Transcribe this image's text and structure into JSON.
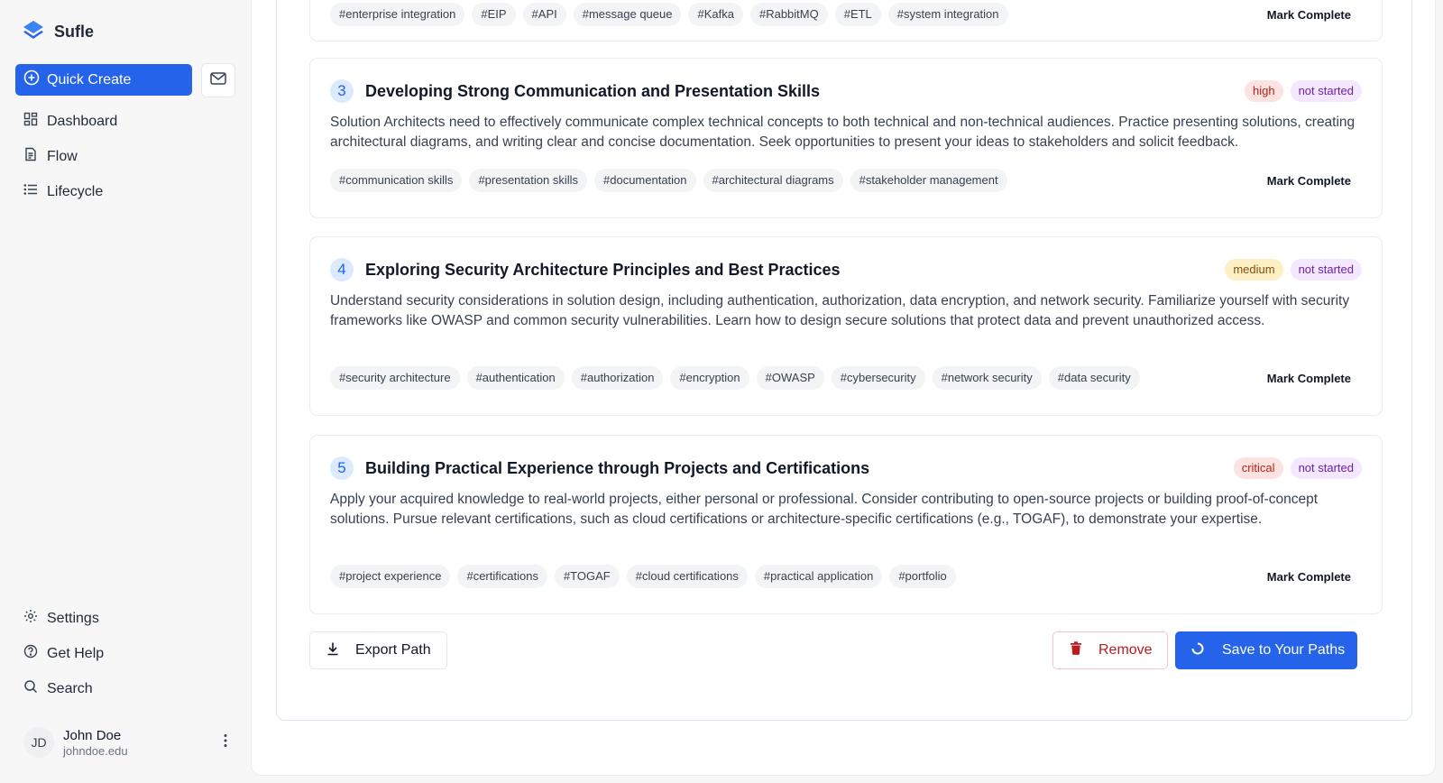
{
  "brand": {
    "name": "Sufle",
    "logo_icon": "layers-icon",
    "accent": "#2563eb"
  },
  "sidebar": {
    "quick_create": "Quick Create",
    "nav": [
      {
        "label": "Dashboard",
        "icon": "dashboard-icon"
      },
      {
        "label": "Flow",
        "icon": "document-icon"
      },
      {
        "label": "Lifecycle",
        "icon": "list-icon"
      }
    ],
    "bottom": [
      {
        "label": "Settings",
        "icon": "gear-icon"
      },
      {
        "label": "Get Help",
        "icon": "help-icon"
      },
      {
        "label": "Search",
        "icon": "search-icon"
      }
    ],
    "user": {
      "initials": "JD",
      "name": "John Doe",
      "email": "johndoe.edu"
    }
  },
  "cards": [
    {
      "tags": [
        "#enterprise integration",
        "#EIP",
        "#API",
        "#message queue",
        "#Kafka",
        "#RabbitMQ",
        "#ETL",
        "#system integration"
      ],
      "mark_label": "Mark Complete"
    },
    {
      "number": "3",
      "title": "Developing Strong Communication and Presentation Skills",
      "priority": "high",
      "status": "not started",
      "description": "Solution Architects need to effectively communicate complex technical concepts to both technical and non-technical audiences. Practice presenting solutions, creating architectural diagrams, and writing clear and concise documentation. Seek opportunities to present your ideas to stakeholders and solicit feedback.",
      "tags": [
        "#communication skills",
        "#presentation skills",
        "#documentation",
        "#architectural diagrams",
        "#stakeholder management"
      ],
      "mark_label": "Mark Complete"
    },
    {
      "number": "4",
      "title": "Exploring Security Architecture Principles and Best Practices",
      "priority": "medium",
      "status": "not started",
      "description": "Understand security considerations in solution design, including authentication, authorization, data encryption, and network security. Familiarize yourself with security frameworks like OWASP and common security vulnerabilities. Learn how to design secure solutions that protect data and prevent unauthorized access.",
      "tags": [
        "#security architecture",
        "#authentication",
        "#authorization",
        "#encryption",
        "#OWASP",
        "#cybersecurity",
        "#network security",
        "#data security"
      ],
      "mark_label": "Mark Complete"
    },
    {
      "number": "5",
      "title": "Building Practical Experience through Projects and Certifications",
      "priority": "critical",
      "status": "not started",
      "description": "Apply your acquired knowledge to real-world projects, either personal or professional. Consider contributing to open-source projects or building proof-of-concept solutions. Pursue relevant certifications, such as cloud certifications or architecture-specific certifications (e.g., TOGAF), to demonstrate your expertise.",
      "tags": [
        "#project experience",
        "#certifications",
        "#TOGAF",
        "#cloud certifications",
        "#practical application",
        "#portfolio"
      ],
      "mark_label": "Mark Complete"
    }
  ],
  "actions": {
    "export": "Export Path",
    "remove": "Remove",
    "save": "Save to Your Paths"
  }
}
